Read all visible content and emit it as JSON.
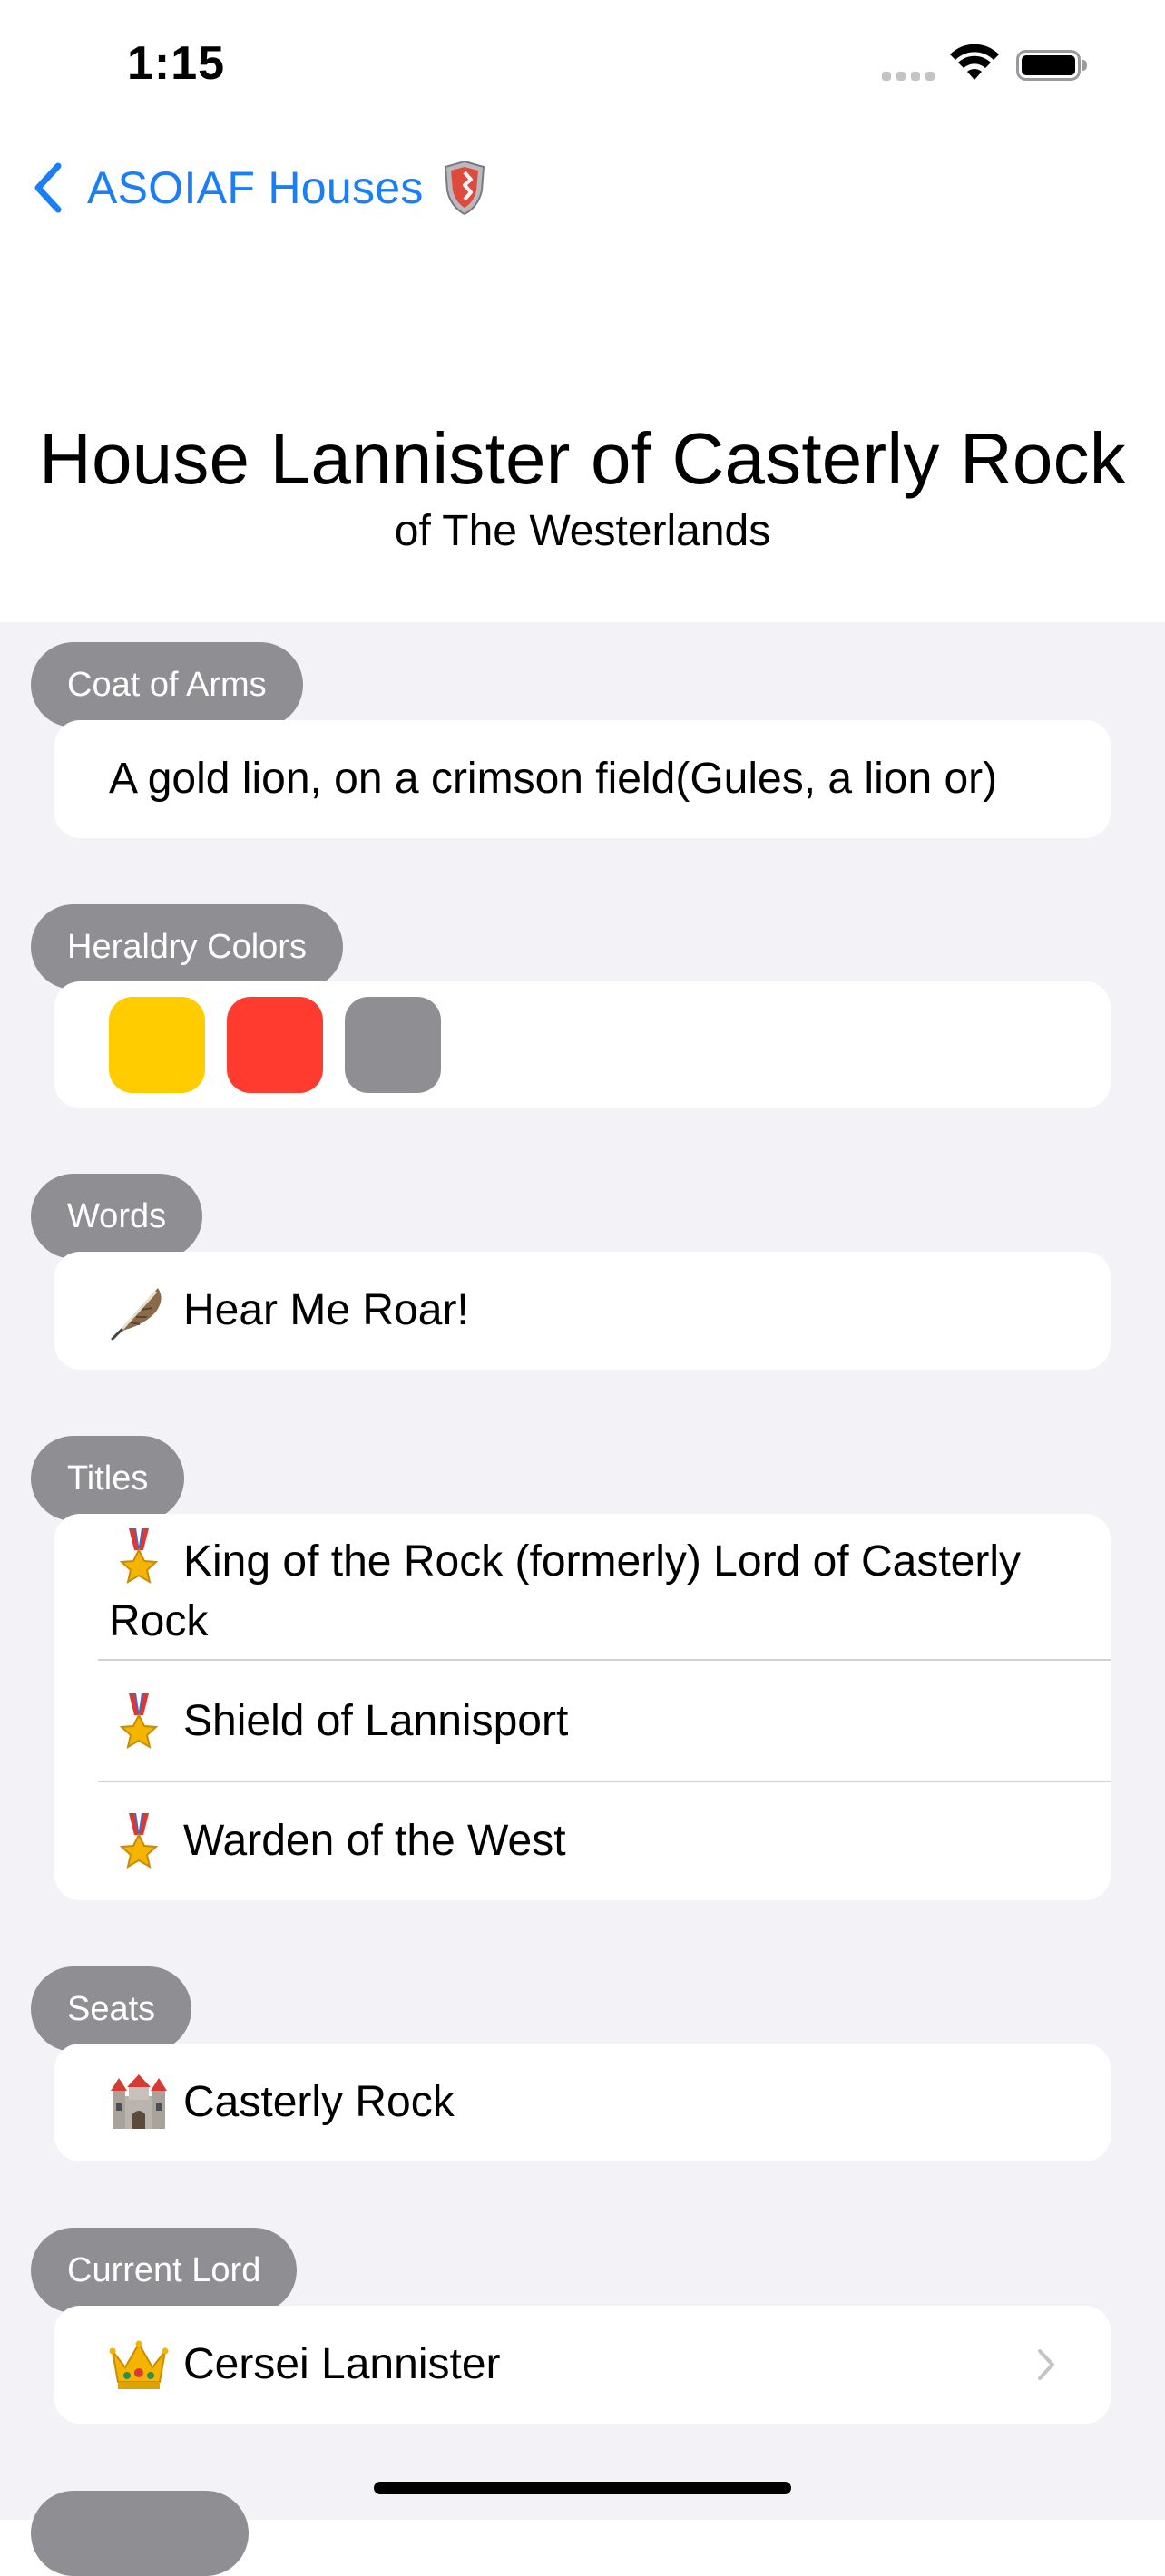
{
  "status_bar": {
    "time": "1:15"
  },
  "nav": {
    "back_label": "ASOIAF Houses"
  },
  "header": {
    "title": "House Lannister of Casterly Rock",
    "subtitle": "of The Westerlands"
  },
  "sections": {
    "coat_of_arms": {
      "header": "Coat of Arms",
      "text": "A gold lion, on a crimson field(Gules, a lion or)"
    },
    "heraldry_colors": {
      "header": "Heraldry Colors",
      "colors": [
        "#ffcc00",
        "#ff3b30",
        "#8e8e93"
      ]
    },
    "words": {
      "header": "Words",
      "icon": "feather-icon",
      "text": "Hear Me Roar!"
    },
    "titles": {
      "header": "Titles",
      "icon": "medal-icon",
      "items": [
        "King of the Rock (formerly) Lord of Casterly Rock",
        "Shield of Lannisport",
        "Warden of the West"
      ]
    },
    "seats": {
      "header": "Seats",
      "icon": "castle-icon",
      "items": [
        "Casterly Rock"
      ]
    },
    "current_lord": {
      "header": "Current Lord",
      "icon": "crown-icon",
      "text": "Cersei Lannister"
    }
  }
}
